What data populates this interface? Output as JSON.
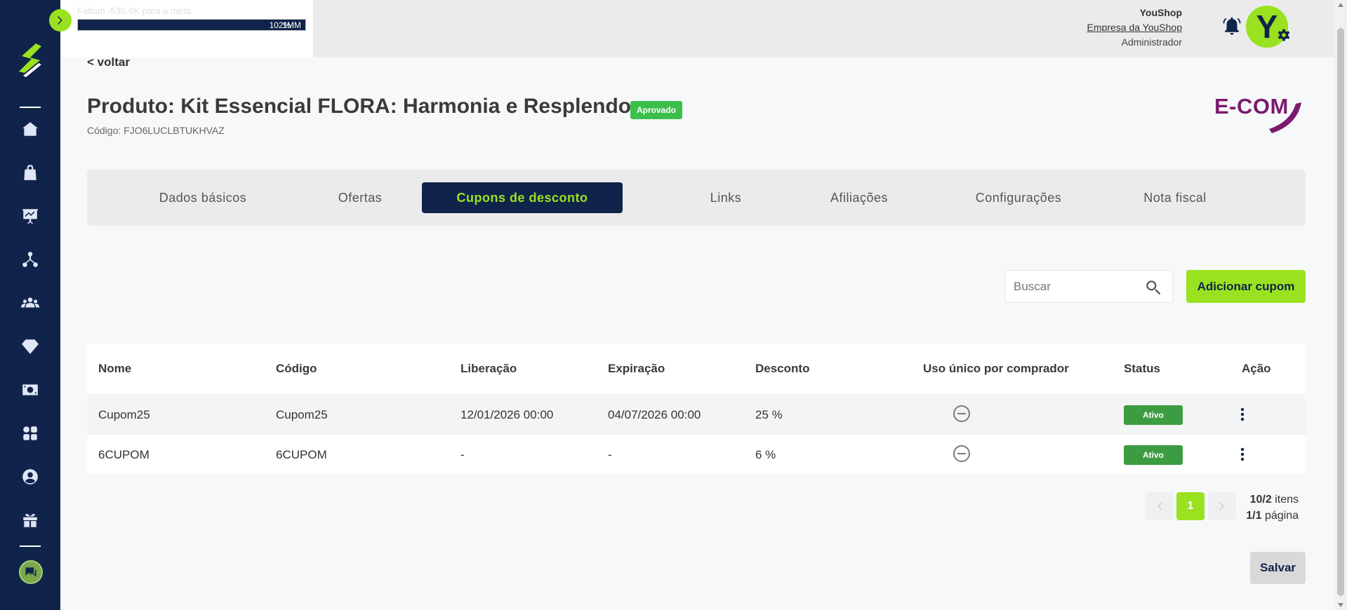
{
  "topbar": {
    "goal_text": "Faltam -535.6K para a meta",
    "goal_bar_label": "102%",
    "goal_bar_label2": "1MM",
    "goal_progress_percent": 100,
    "user_name": "YouShop",
    "user_company": "Empresa da YouShop",
    "user_role": "Administrador",
    "avatar_letter": "Y"
  },
  "page": {
    "back_label": "< voltar",
    "title": "Produto: Kit Essencial FLORA: Harmonia e Resplendor",
    "status": "Aprovado",
    "code": "Código: FJO6LUCLBTUKHVAZ",
    "brand": "E-COM"
  },
  "tabs": [
    {
      "label": "Dados básicos",
      "active": false
    },
    {
      "label": "Ofertas",
      "active": false
    },
    {
      "label": "Cupons de desconto",
      "active": true
    },
    {
      "label": "Links",
      "active": false
    },
    {
      "label": "Afiliações",
      "active": false
    },
    {
      "label": "Configurações",
      "active": false
    },
    {
      "label": "Nota fiscal",
      "active": false
    }
  ],
  "toolbar": {
    "search_placeholder": "Buscar",
    "search_value": "",
    "add_label": "Adicionar cupom"
  },
  "table": {
    "headers": [
      "Nome",
      "Código",
      "Liberação",
      "Expiração",
      "Desconto",
      "Uso único por comprador",
      "Status",
      "Ação"
    ],
    "rows": [
      {
        "nome": "Cupom25",
        "codigo": "Cupom25",
        "liberacao": "12/01/2026 00:00",
        "expiracao": "04/07/2026 00:00",
        "desconto": "25 %",
        "uso_unico": "minus-circle-icon",
        "status": "Ativo"
      },
      {
        "nome": "6CUPOM",
        "codigo": "6CUPOM",
        "liberacao": "-",
        "expiracao": "-",
        "desconto": "6 %",
        "uso_unico": "minus-circle-icon",
        "status": "Ativo"
      }
    ]
  },
  "pagination": {
    "current": "1",
    "items_count": "10/2",
    "items_label": " itens",
    "pages_count": "1/1",
    "pages_label": " página"
  },
  "footer": {
    "save_label": "Salvar"
  },
  "colors": {
    "sidebar": "#10244b",
    "accent": "#9ae21f",
    "status_green": "#3d9c41",
    "brand_purple": "#7b1a6e"
  }
}
